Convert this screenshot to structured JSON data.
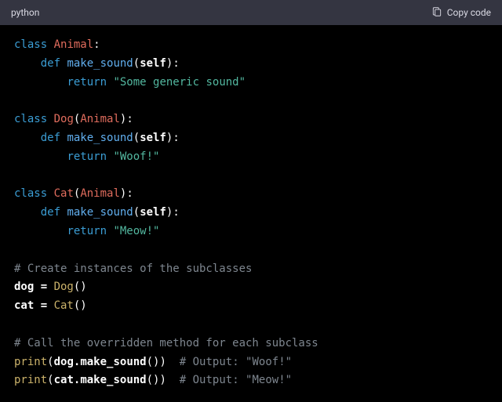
{
  "header": {
    "language": "python",
    "copy_label": "Copy code"
  },
  "tokens": {
    "kw_class": "class",
    "kw_def": "def",
    "kw_return": "return",
    "cls_Animal": "Animal",
    "cls_Dog": "Dog",
    "cls_Cat": "Cat",
    "fn_make_sound": "make_sound",
    "self": "self",
    "str_generic": "\"Some generic sound\"",
    "str_woof": "\"Woof!\"",
    "str_meow": "\"Meow!\"",
    "cmt_instances": "# Create instances of the subclasses",
    "cmt_call": "# Call the overridden method for each subclass",
    "cmt_out_woof": "# Output: \"Woof!\"",
    "cmt_out_meow": "# Output: \"Meow!\"",
    "var_dog_decl": "dog = ",
    "var_cat_decl": "cat = ",
    "call_Dog": "Dog",
    "call_Cat": "Cat",
    "call_print": "print",
    "dot_make_sound": ".make_sound",
    "ident_dog": "dog",
    "ident_cat": "cat"
  }
}
